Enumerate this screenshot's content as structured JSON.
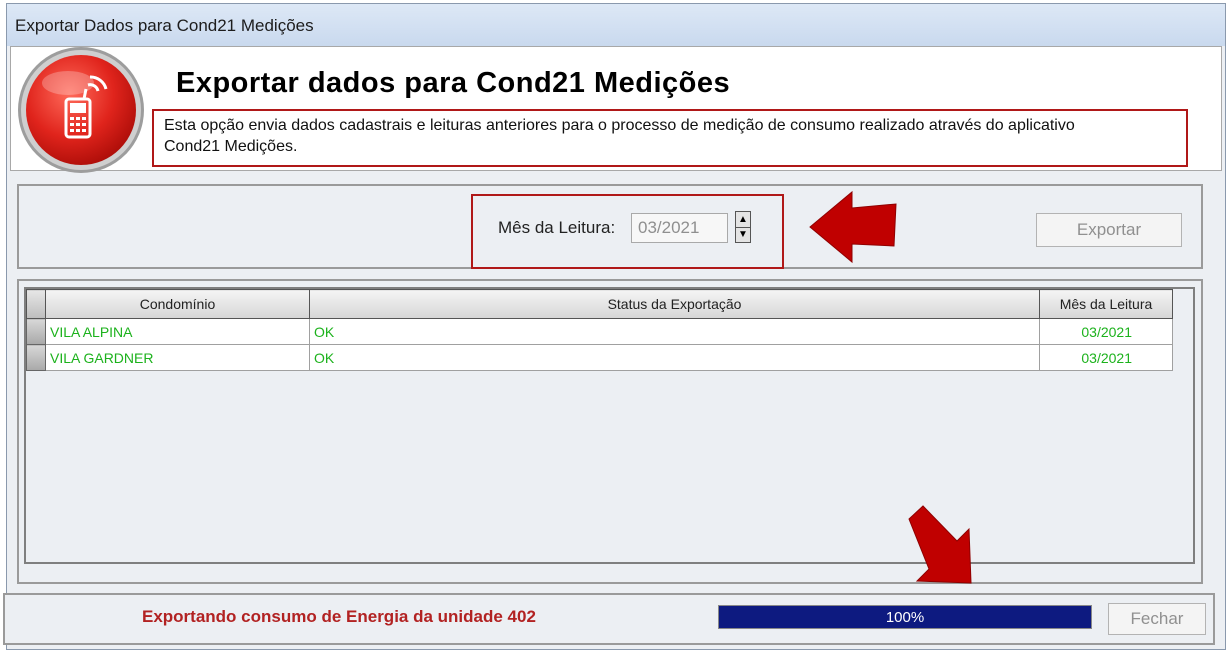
{
  "window": {
    "title": "Exportar Dados para Cond21 Medições"
  },
  "header": {
    "title": "Exportar dados para Cond21 Medições",
    "description_line1": "Esta opção envia dados cadastrais e leituras anteriores para o processo de medição de consumo realizado através do aplicativo",
    "description_line2": "Cond21 Medições.",
    "logo_icon": "mobile-phone-icon"
  },
  "filter": {
    "month_label": "Mês da Leitura:",
    "month_value": "03/2021",
    "export_label": "Exportar"
  },
  "grid": {
    "columns": [
      "Condomínio",
      "Status da Exportação",
      "Mês da Leitura"
    ],
    "rows": [
      {
        "condominio": "VILA ALPINA",
        "status": "OK",
        "mes": "03/2021"
      },
      {
        "condominio": "VILA GARDNER",
        "status": "OK",
        "mes": "03/2021"
      }
    ]
  },
  "footer": {
    "status_text": "Exportando consumo de Energia da unidade 402",
    "progress_percent": 100,
    "progress_label": "100%",
    "close_label": "Fechar"
  },
  "colors": {
    "accent_red": "#b01818",
    "ok_green": "#1cb21c",
    "progress_blue": "#0d1a80"
  }
}
